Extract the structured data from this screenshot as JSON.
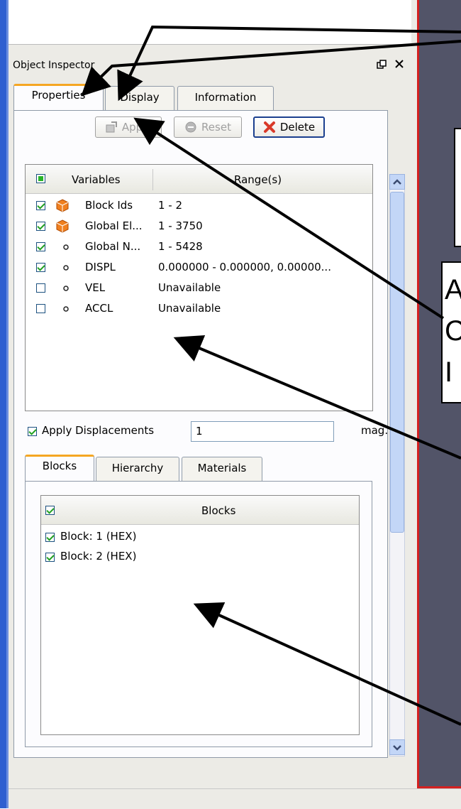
{
  "inspector": {
    "title": "Object Inspector",
    "float_icon": "float-window-icon",
    "close_icon": "close-icon",
    "tabs": [
      {
        "label": "Properties",
        "active": true
      },
      {
        "label": "Display",
        "active": false
      },
      {
        "label": "Information",
        "active": false
      }
    ],
    "buttons": {
      "apply": "Apply",
      "reset": "Reset",
      "delete": "Delete"
    },
    "variables_table": {
      "headers": [
        "Variables",
        "Range(s)"
      ],
      "rows": [
        {
          "checked": true,
          "icon": "cube-icon",
          "name": "Block Ids",
          "range": "1 - 2"
        },
        {
          "checked": true,
          "icon": "cube-icon",
          "name": "Global El...",
          "range": "1 - 3750"
        },
        {
          "checked": true,
          "icon": "point-icon",
          "name": "Global N...",
          "range": "1 - 5428"
        },
        {
          "checked": true,
          "icon": "point-icon",
          "name": "DISPL",
          "range": "0.000000 - 0.000000, 0.00000..."
        },
        {
          "checked": false,
          "icon": "point-icon",
          "name": "VEL",
          "range": "Unavailable"
        },
        {
          "checked": false,
          "icon": "point-icon",
          "name": "ACCL",
          "range": "Unavailable"
        }
      ]
    },
    "apply_displacements": {
      "checked": true,
      "label": "Apply Displacements",
      "value": "1",
      "suffix": "mag."
    },
    "sub_tabs": [
      {
        "label": "Blocks",
        "active": true
      },
      {
        "label": "Hierarchy",
        "active": false
      },
      {
        "label": "Materials",
        "active": false
      }
    ],
    "blocks_table": {
      "header": "Blocks",
      "rows": [
        {
          "checked": true,
          "label": "Block: 1 (HEX)"
        },
        {
          "checked": true,
          "label": "Block: 2 (HEX)"
        }
      ]
    }
  },
  "annotations": {
    "box_letters_1": "A",
    "box_letters_2": "C",
    "box_letters_3": "I"
  },
  "colors": {
    "viewport_bg": "#525468",
    "viewport_border": "#d42020",
    "tab_accent": "#f5a623",
    "panel_bg": "#ecebe6",
    "scrollbar": "#c3d6f7"
  }
}
